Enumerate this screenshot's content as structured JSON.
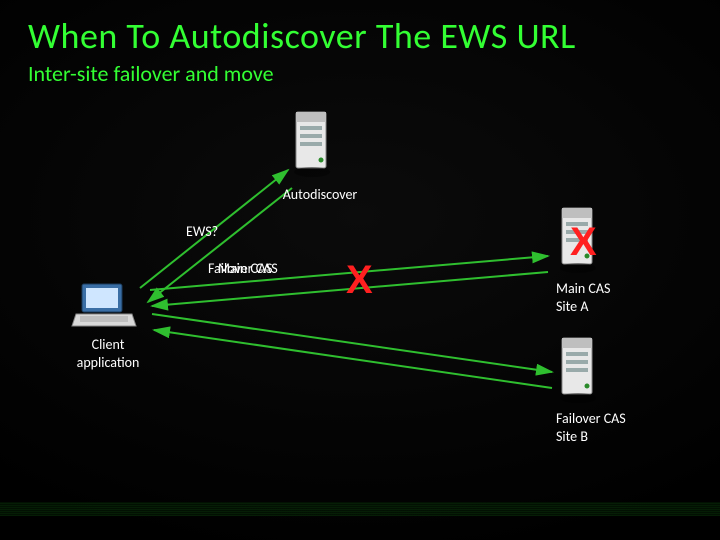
{
  "title": "When To Autodiscover The EWS URL",
  "subtitle": "Inter-site failover and move",
  "nodes": {
    "client": {
      "label": "Client\napplication"
    },
    "autodiscover": {
      "label": "Autodiscover"
    },
    "main_cas": {
      "label": "Main CAS\nSite A"
    },
    "failover_cas": {
      "label": "Failover CAS\nSite B"
    }
  },
  "edge_labels": {
    "ews_question": "EWS?",
    "main_cas_reply": "Main CAS",
    "failover_cas_reply": "Failover CAS"
  },
  "markers": {
    "x1": "X",
    "x2": "X"
  },
  "colors": {
    "accent": "#33ff33",
    "arrow": "#2fbf2f",
    "fail": "#ff2020"
  }
}
